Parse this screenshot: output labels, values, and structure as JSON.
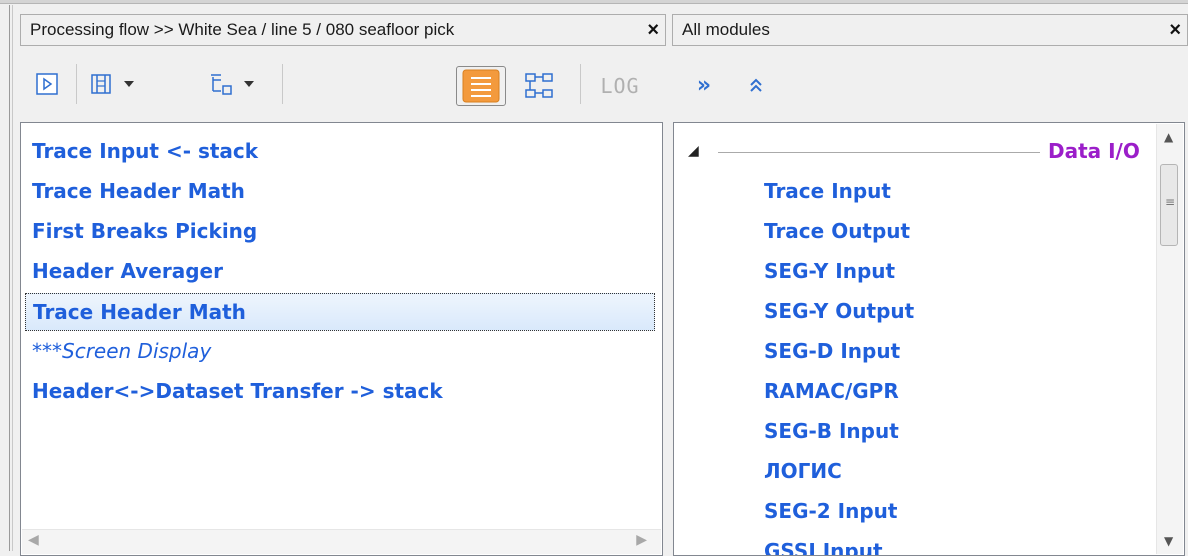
{
  "colors": {
    "item_blue": "#1f5fdb",
    "group_purple": "#9b1ec9",
    "active_toggle": "#f39a3d"
  },
  "flow_panel": {
    "title": "Processing flow >> White Sea / line 5 / 080 seafloor pick",
    "close_label": "×",
    "toolbar": {
      "run_icon": "play-icon",
      "view_icon": "columns-icon",
      "tree_icon": "tree-icon",
      "list_mode_icon": "list-icon",
      "tree_mode_icon": "hierarchy-icon",
      "log_label": "LOG"
    },
    "items": [
      {
        "label": "Trace Input <- stack",
        "state": "normal"
      },
      {
        "label": "Trace Header Math",
        "state": "normal"
      },
      {
        "label": "First Breaks Picking",
        "state": "normal"
      },
      {
        "label": "Header Averager",
        "state": "normal"
      },
      {
        "label": "Trace Header Math",
        "state": "selected"
      },
      {
        "label": "***Screen Display",
        "state": "commented"
      },
      {
        "label": "Header<->Dataset Transfer -> stack",
        "state": "normal"
      }
    ]
  },
  "modules_panel": {
    "title": "All modules",
    "close_label": "×",
    "toolbar": {
      "expand_label": "»",
      "collapse_label": "︽"
    },
    "group": {
      "name": "Data I/O",
      "modules": [
        "Trace Input",
        "Trace Output",
        "SEG-Y Input",
        "SEG-Y Output",
        "SEG-D Input",
        "RAMAC/GPR",
        "SEG-B Input",
        "ЛОГИС",
        "SEG-2 Input",
        "GSSI Input"
      ]
    }
  }
}
